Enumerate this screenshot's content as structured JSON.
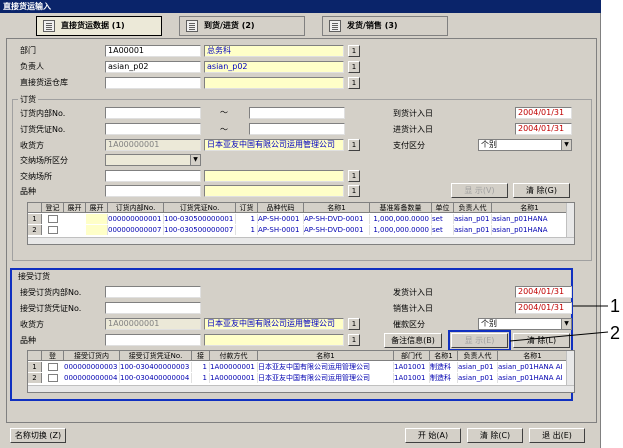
{
  "window": {
    "title": "直接货运输入"
  },
  "tabs": [
    {
      "label": "直接货运数据 (1)"
    },
    {
      "label": "到货/进货 (2)"
    },
    {
      "label": "发货/销售 (3)"
    }
  ],
  "header": {
    "dept_label": "部门",
    "dept_code": "1A00001",
    "dept_name": "总务科",
    "person_label": "负责人",
    "person_code": "asian_p02",
    "person_name": "asian_p02",
    "warehouse_label": "直接货运仓库",
    "search_btn": "1"
  },
  "order": {
    "section_label": "订货",
    "internal_no_label": "订货内部No.",
    "voucher_no_label": "订货凭证No.",
    "tilde": "～",
    "receiver_label": "收货方",
    "receiver_code": "1A00000001",
    "receiver_name": "日本亚友中国有限公司运用管理公司",
    "place_type_label": "交纳场所区分",
    "place_label": "交纳场所",
    "item_label": "品种",
    "arrival_label": "到货计入日",
    "arrival_date": "2004/01/31",
    "purchase_label": "进货计入日",
    "purchase_date": "2004/01/31",
    "payment_label": "支付区分",
    "payment_value": "个别",
    "show_btn": "显 示(V)",
    "clear_btn": "清 除(G)"
  },
  "order_grid": {
    "headers": [
      "登记",
      "展开",
      "展开",
      "订货内部No.",
      "订货凭证No.",
      "订货",
      "品种代码",
      "名称1",
      "基准筹备数量",
      "单位",
      "负责人代",
      "名称1"
    ],
    "rows": [
      {
        "num": "1",
        "internal": "000000000001",
        "voucher": "100-030500000001",
        "qty": "1",
        "code": "AP-SH-0001",
        "name": "AP-SH-DVD-0001",
        "base_qty": "1,000,000.0000",
        "unit": "set",
        "person": "asian_p01",
        "pname": "asian_p01HANA"
      },
      {
        "num": "2",
        "internal": "000000000007",
        "voucher": "100-030500000007",
        "qty": "1",
        "code": "AP-SH-0001",
        "name": "AP-SH-DVD-0001",
        "base_qty": "1,000,000.0000",
        "unit": "set",
        "person": "asian_p01",
        "pname": "asian_p01HANA"
      }
    ]
  },
  "received": {
    "section_label": "接受订货",
    "internal_no_label": "接受订货内部No.",
    "voucher_no_label": "接受订货凭证No.",
    "payer_label": "收货方",
    "payer_code": "1A00000001",
    "payer_name": "日本亚友中国有限公司运用管理公司",
    "item_label": "品种",
    "ship_label": "发货计入日",
    "ship_date": "2004/01/31",
    "sales_label": "销售计入日",
    "sales_date": "2004/01/31",
    "collect_label": "催款区分",
    "collect_value": "个别",
    "memo_btn": "备注信息(B)",
    "show_btn": "显 示(E)",
    "clear_btn": "清 除(L)"
  },
  "received_grid": {
    "headers": [
      "登",
      "接受订货内",
      "接受订货凭证No.",
      "接",
      "付款方代",
      "名称1",
      "部门代",
      "名称1",
      "负责人代",
      "名称1"
    ],
    "rows": [
      {
        "num": "1",
        "internal": "000000000003",
        "voucher": "100-030400000003",
        "qty": "1",
        "payer": "1A00000001",
        "name": "日本亚友中国有限公司运用管理公司",
        "dept": "1A01001",
        "dname": "制造科",
        "person": "asian_p01",
        "pname": "asian_p01HANA AI"
      },
      {
        "num": "2",
        "internal": "000000000004",
        "voucher": "100-030400000004",
        "qty": "1",
        "payer": "1A00000001",
        "name": "日本亚友中国有限公司运用管理公司",
        "dept": "1A01001",
        "dname": "制造科",
        "person": "asian_p01",
        "pname": "asian_p01HANA AI"
      }
    ]
  },
  "footer": {
    "name_switch": "名称切换 (Z)",
    "start": "开 始(A)",
    "clear": "清 除(C)",
    "exit": "退 出(E)"
  },
  "callouts": {
    "one": "1",
    "two": "2"
  }
}
